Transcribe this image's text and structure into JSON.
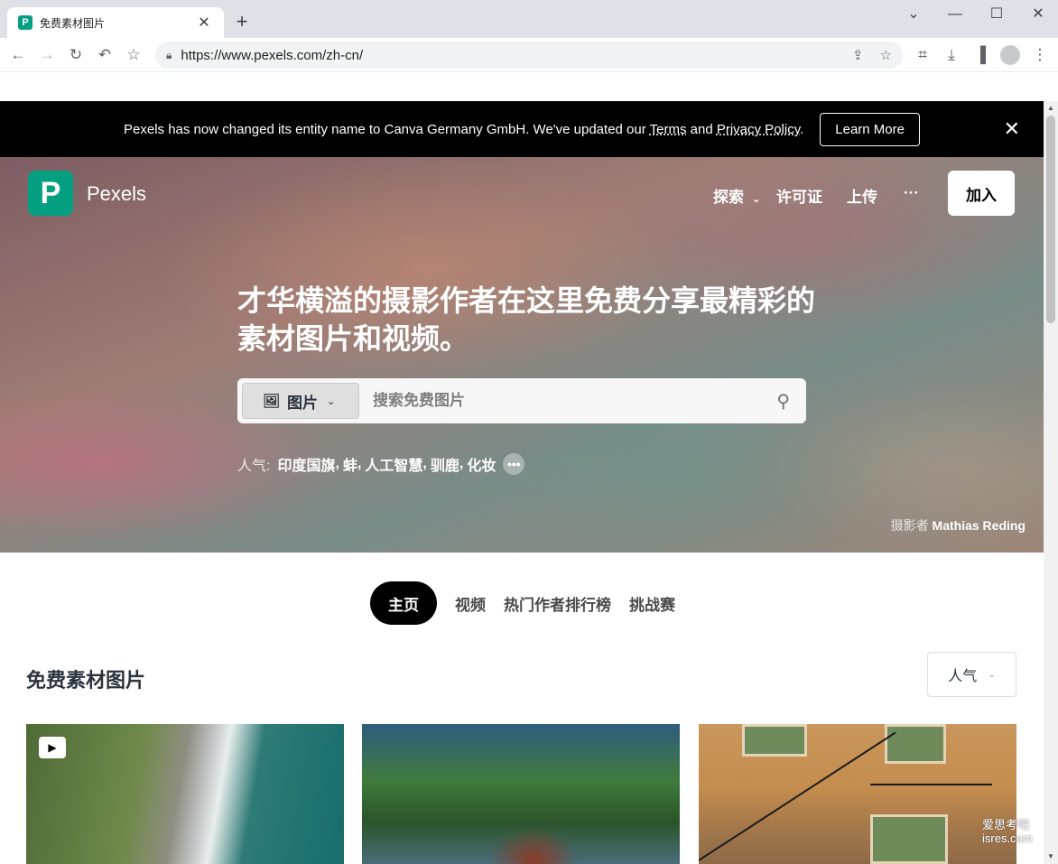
{
  "browser": {
    "tab_title": "免费素材图片",
    "favicon_letter": "P",
    "url": "https://www.pexels.com/zh-cn/",
    "new_tab": "+",
    "window_controls": [
      "chevron-down-icon",
      "minimize-icon",
      "maximize-icon",
      "close-icon"
    ]
  },
  "banner": {
    "text_before": "Pexels has now changed its entity name to Canva Germany GmbH. We've updated our ",
    "terms_link": "Terms",
    "and": " and ",
    "privacy_link": "Privacy Policy",
    "period": ".",
    "learn_more": "Learn More"
  },
  "header": {
    "logo_letter": "P",
    "logo_text": "Pexels",
    "nav": {
      "explore": "探索",
      "license": "许可证",
      "upload": "上传",
      "more": "···"
    },
    "join": "加入"
  },
  "hero": {
    "headline": "才华横溢的摄影作者在这里免费分享最精彩的素材图片和视频。",
    "search": {
      "type_label": "图片",
      "placeholder": "搜索免费图片"
    },
    "popular": {
      "label": "人气:",
      "tags": [
        "印度国旗",
        "蚌",
        "人工智慧",
        "驯鹿",
        "化妆"
      ]
    },
    "credit_prefix": "摄影者 ",
    "credit_name": "Mathias Reding"
  },
  "tabs": [
    "主页",
    "视频",
    "热门作者排行榜",
    "挑战赛"
  ],
  "section": {
    "title": "免费素材图片",
    "sort_label": "人气"
  },
  "watermark": {
    "line1": "爱思考吧",
    "line2": "isres.com"
  },
  "colors": {
    "brand": "#05a081",
    "banner_bg": "#000000"
  }
}
